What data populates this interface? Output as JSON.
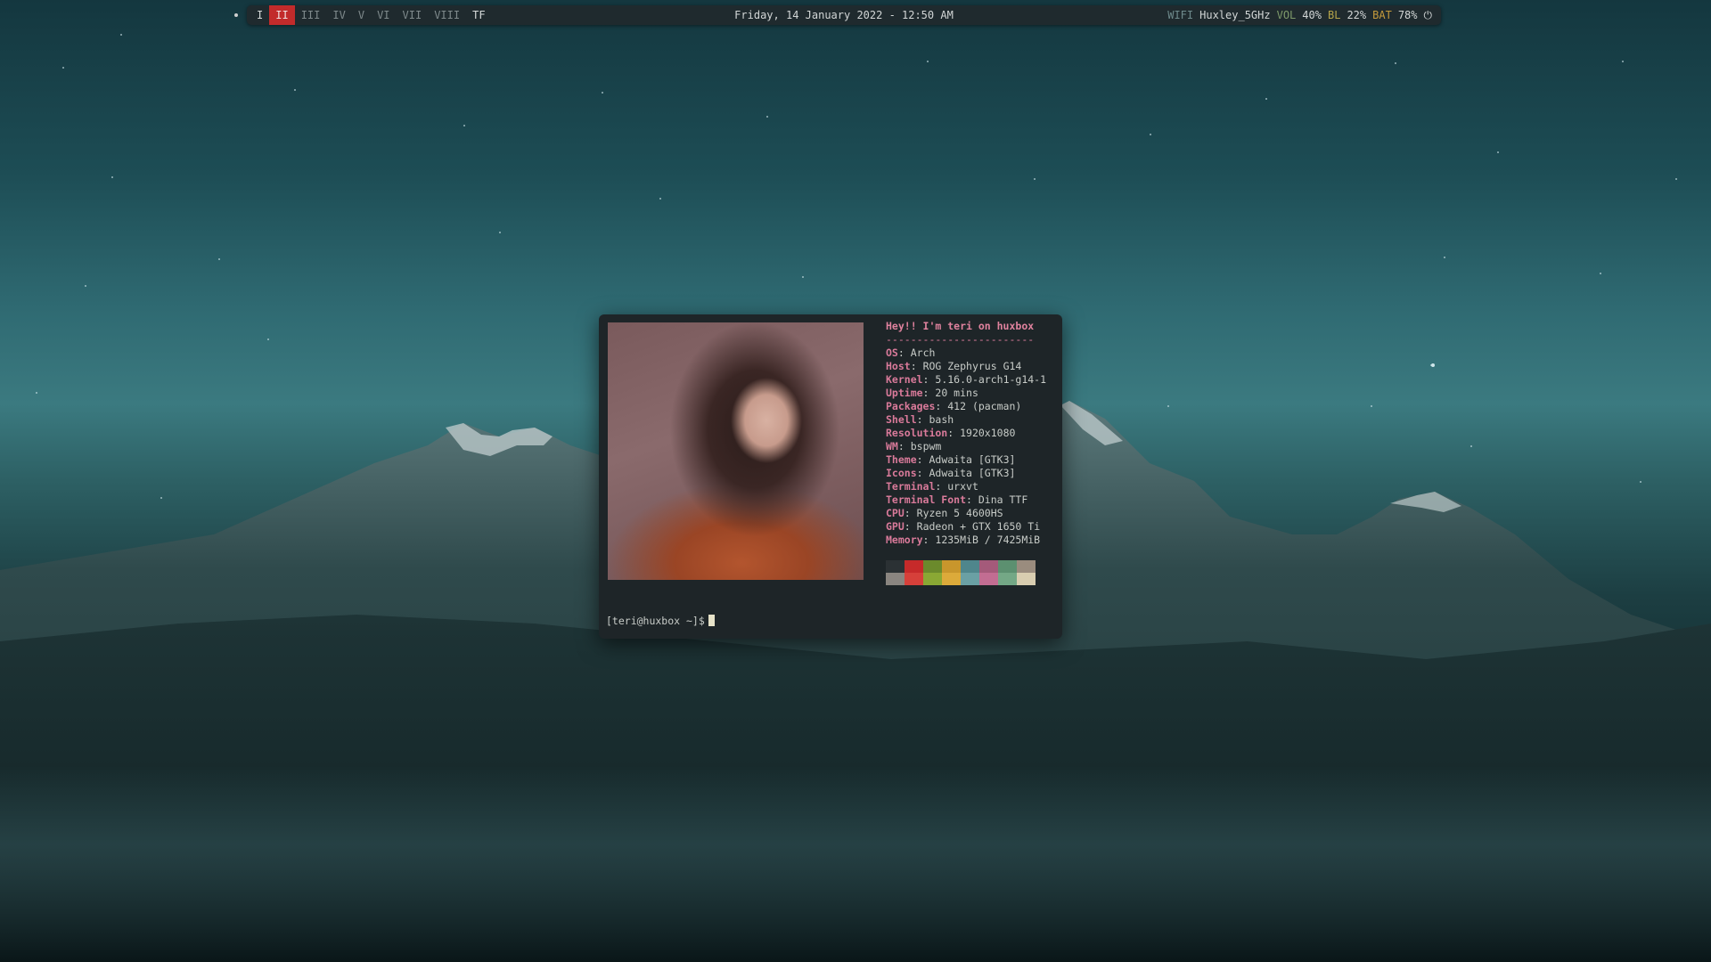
{
  "bar": {
    "workspaces": [
      {
        "label": "I",
        "state": "occupied"
      },
      {
        "label": "II",
        "state": "active"
      },
      {
        "label": "III",
        "state": "empty"
      },
      {
        "label": "IV",
        "state": "empty"
      },
      {
        "label": "V",
        "state": "empty"
      },
      {
        "label": "VI",
        "state": "empty"
      },
      {
        "label": "VII",
        "state": "empty"
      },
      {
        "label": "VIII",
        "state": "empty"
      },
      {
        "label": "TF",
        "state": "occupied"
      }
    ],
    "clock": "Friday, 14 January 2022 - 12:50 AM",
    "wifi_label": "WIFI",
    "wifi_ssid": "Huxley_5GHz",
    "vol_label": "VOL",
    "vol_value": "40%",
    "bl_label": "BL",
    "bl_value": "22%",
    "bat_label": "BAT",
    "bat_value": "78%",
    "power_icon": "power-icon",
    "colors": {
      "active_ws": "#c22b2b",
      "bar_bg": "#1f2a2e"
    }
  },
  "terminal": {
    "title_line": "Hey!! I'm teri on huxbox",
    "separator": "------------------------",
    "fields": [
      {
        "key": "OS",
        "value": "Arch"
      },
      {
        "key": "Host",
        "value": "ROG Zephyrus G14"
      },
      {
        "key": "Kernel",
        "value": "5.16.0-arch1-g14-1"
      },
      {
        "key": "Uptime",
        "value": "20 mins"
      },
      {
        "key": "Packages",
        "value": "412 (pacman)"
      },
      {
        "key": "Shell",
        "value": "bash"
      },
      {
        "key": "Resolution",
        "value": "1920x1080"
      },
      {
        "key": "WM",
        "value": "bspwm"
      },
      {
        "key": "Theme",
        "value": "Adwaita [GTK3]"
      },
      {
        "key": "Icons",
        "value": "Adwaita [GTK3]"
      },
      {
        "key": "Terminal",
        "value": "urxvt"
      },
      {
        "key": "Terminal Font",
        "value": "Dina TTF"
      },
      {
        "key": "CPU",
        "value": "Ryzen 5 4600HS"
      },
      {
        "key": "GPU",
        "value": "Radeon + GTX 1650 Ti"
      },
      {
        "key": "Memory",
        "value": "1235MiB / 7425MiB"
      }
    ],
    "palette_top": [
      "#2b3134",
      "#c62a2a",
      "#6b8a2c",
      "#c8962c",
      "#4f868c",
      "#a45a7a",
      "#5c9070",
      "#9a8c7e"
    ],
    "palette_bottom": [
      "#8a8580",
      "#d6403a",
      "#8aa834",
      "#dcaa3a",
      "#6aa0a4",
      "#c26d92",
      "#74a886",
      "#d8cdb0"
    ],
    "prompt": "[teri@huxbox ~]$"
  }
}
